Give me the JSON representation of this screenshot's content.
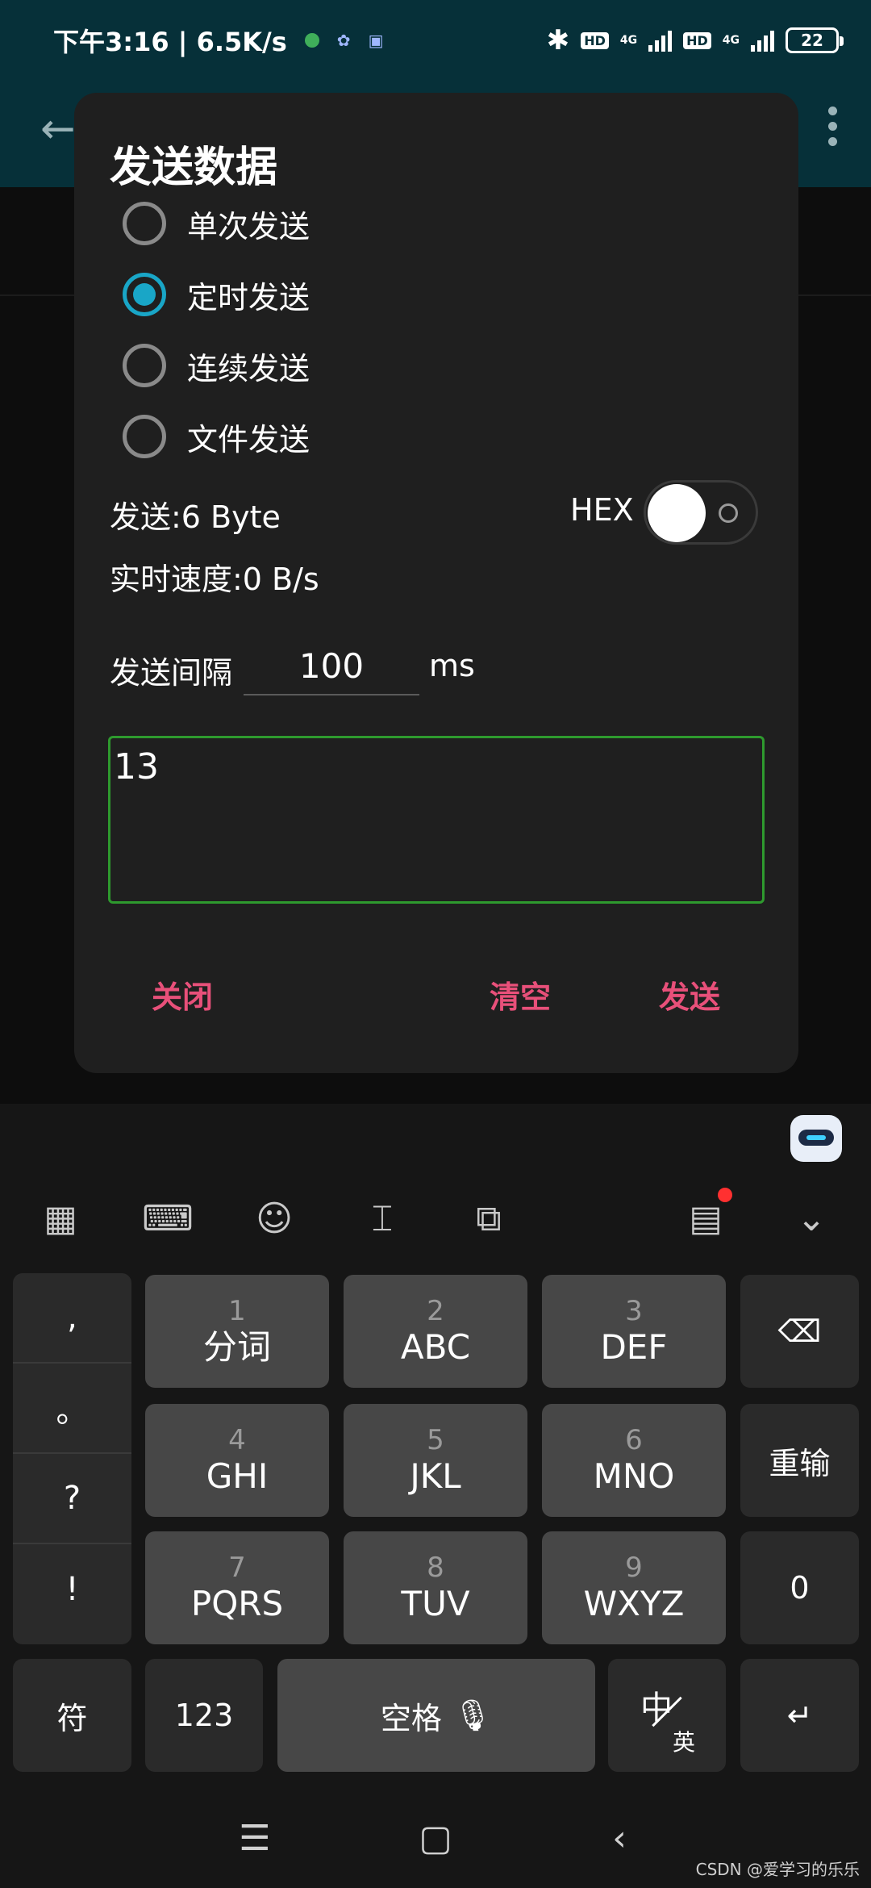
{
  "status_bar": {
    "time_speed": "下午3:16 | 6.5K/s",
    "hd1": "HD",
    "net1": "4G",
    "hd2": "HD",
    "net2": "4G",
    "battery": "22"
  },
  "dialog": {
    "title": "发送数据",
    "radio_options": [
      {
        "label": "单次发送",
        "checked": false
      },
      {
        "label": "定时发送",
        "checked": true
      },
      {
        "label": "连续发送",
        "checked": false
      },
      {
        "label": "文件发送",
        "checked": false
      }
    ],
    "sent_bytes": "发送:6 Byte",
    "hex_label": "HEX",
    "hex_enabled": false,
    "rate": "实时速度:0 B/s",
    "interval_label": "发送间隔",
    "interval_value": "100",
    "interval_unit": "ms",
    "data_text": "13",
    "buttons": {
      "close": "关闭",
      "clear": "清空",
      "send": "发送"
    },
    "accent_color": "#19a6c7",
    "button_color": "#e8507a",
    "input_border_color": "#2e9a2e"
  },
  "keyboard": {
    "punctuation": [
      ",",
      "。",
      "?",
      "!"
    ],
    "keys": [
      {
        "num": "1",
        "letters": "分词"
      },
      {
        "num": "2",
        "letters": "ABC"
      },
      {
        "num": "3",
        "letters": "DEF"
      },
      {
        "num": "4",
        "letters": "GHI"
      },
      {
        "num": "5",
        "letters": "JKL"
      },
      {
        "num": "6",
        "letters": "MNO"
      },
      {
        "num": "7",
        "letters": "PQRS"
      },
      {
        "num": "8",
        "letters": "TUV"
      },
      {
        "num": "9",
        "letters": "WXYZ"
      }
    ],
    "reinput": "重输",
    "zero": "0",
    "symbol": "符",
    "num_mode": "123",
    "space": "空格",
    "lang_zh": "中",
    "lang_en": "英"
  },
  "watermark": "CSDN @爱学习的乐乐"
}
